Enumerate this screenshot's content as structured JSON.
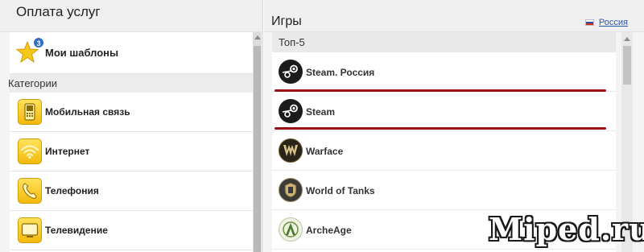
{
  "left_panel": {
    "title": "Оплата услуг",
    "templates": {
      "label": "Мои шаблоны",
      "badge": "3"
    },
    "categories_header": "Категории",
    "categories": [
      {
        "label": "Мобильная связь",
        "icon": "mobile-phone-icon"
      },
      {
        "label": "Интернет",
        "icon": "wifi-icon"
      },
      {
        "label": "Телефония",
        "icon": "telephone-handset-icon"
      },
      {
        "label": "Телевидение",
        "icon": "tv-icon"
      }
    ]
  },
  "right_panel": {
    "title": "Игры",
    "region_link": "Россия",
    "section_header": "Топ-5",
    "games": [
      {
        "label": "Steam. Россия",
        "icon": "steam-icon"
      },
      {
        "label": "Steam",
        "icon": "steam-icon"
      },
      {
        "label": "Warface",
        "icon": "warface-icon"
      },
      {
        "label": "World of Tanks",
        "icon": "world-of-tanks-icon"
      },
      {
        "label": "ArcheAge",
        "icon": "archeage-icon"
      }
    ],
    "highlight_color": "#9b0d14"
  },
  "watermark": "Miped.ru"
}
